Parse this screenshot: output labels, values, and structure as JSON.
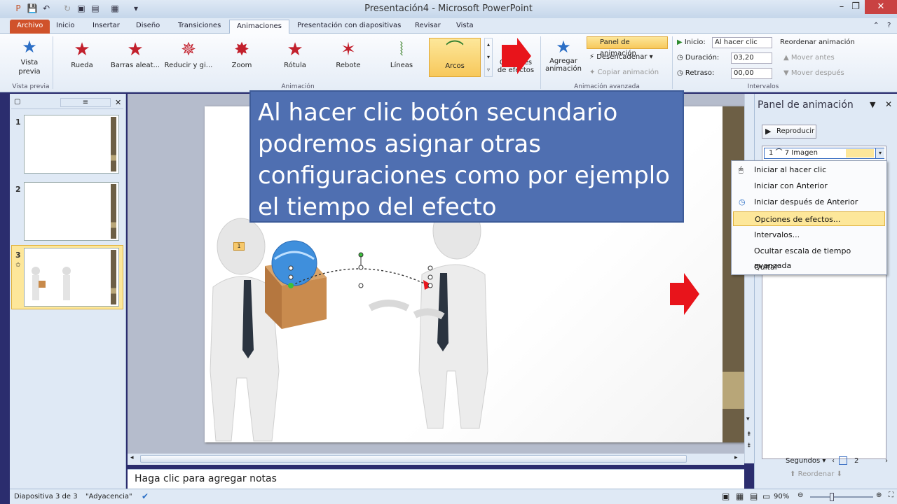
{
  "window": {
    "title": "Presentación4 - Microsoft PowerPoint"
  },
  "tabs": [
    "Archivo",
    "Inicio",
    "Insertar",
    "Diseño",
    "Transiciones",
    "Animaciones",
    "Presentación con diapositivas",
    "Revisar",
    "Vista"
  ],
  "ribbon": {
    "preview_label": "Vista previa",
    "preview_group": "Vista previa",
    "animations": [
      "Rueda",
      "Barras aleat...",
      "Reducir y gi...",
      "Zoom",
      "Rótula",
      "Rebote",
      "Líneas",
      "Arcos"
    ],
    "effect_options_label": "Opciones de efectos",
    "animation_group": "Animación",
    "add_animation": "Agregar animación",
    "panel_button": "Panel de animación",
    "trigger": "Desencadenar",
    "copy_anim": "Copiar animación",
    "advanced_group": "Animación avanzada",
    "start_label": "Inicio:",
    "start_value": "Al hacer clic",
    "duration_label": "Duración:",
    "duration_value": "03,20",
    "delay_label": "Retraso:",
    "delay_value": "00,00",
    "reorder_label": "Reordenar animación",
    "move_earlier": "Mover antes",
    "move_later": "Mover después",
    "timing_group": "Intervalos"
  },
  "slides": [
    {
      "num": "1"
    },
    {
      "num": "2"
    },
    {
      "num": "3"
    }
  ],
  "callout_text": "Al hacer clic botón secundario podremos asignar otras configuraciones como por ejemplo el tiempo del efecto",
  "anim_tag": "1",
  "pane": {
    "title": "Panel de animación",
    "play": "Reproducir",
    "item": "1 ⌒ 7 Imagen",
    "seconds": "Segundos",
    "page": "2",
    "reorder": "Reordenar"
  },
  "context_menu": [
    "Iniciar al hacer clic",
    "Iniciar con Anterior",
    "Iniciar después de Anterior",
    "Opciones de efectos...",
    "Intervalos...",
    "Ocultar escala de tiempo avanzada",
    "Quitar"
  ],
  "notes_placeholder": "Haga clic para agregar notas",
  "status": {
    "slide": "Diapositiva 3 de 3",
    "theme": "\"Adyacencia\"",
    "zoom": "90%"
  },
  "colors": {
    "accent": "#d0522b",
    "callout": "#4f6fb1",
    "highlight": "#fde79a",
    "arrow": "#e8141b"
  }
}
